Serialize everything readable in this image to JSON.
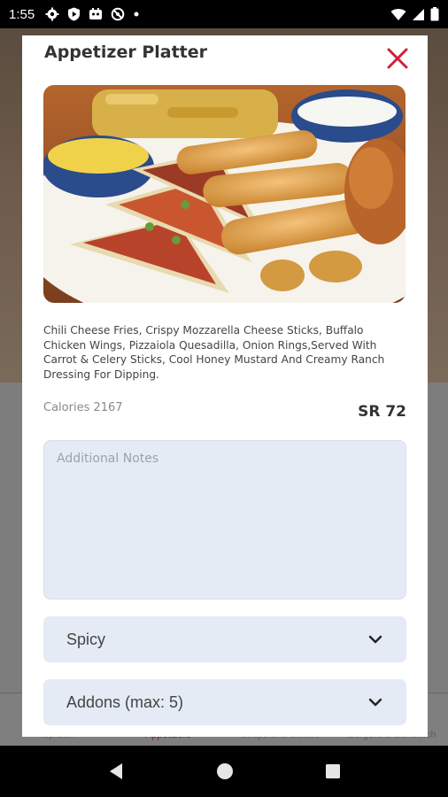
{
  "status_bar": {
    "time": "1:55",
    "icons": [
      "gear-icon",
      "play-shield-icon",
      "robot-icon",
      "no-sync-icon",
      "dot-icon"
    ],
    "right_icons": [
      "wifi-icon",
      "signal-icon",
      "battery-icon"
    ]
  },
  "background_tabs": [
    "Top Sell",
    "Appetizers",
    "Soups and Salads",
    "Burgers & Sandwich"
  ],
  "modal": {
    "title": "Appetizer Platter",
    "description": "Chili Cheese Fries, Crispy Mozzarella Cheese Sticks, Buffalo Chicken Wings, Pizzaiola Quesadilla, Onion Rings,Served With Carrot & Celery Sticks, Cool Honey Mustard And Creamy Ranch Dressing For Dipping.",
    "calories": "Calories 2167",
    "price": "SR 72",
    "notes_placeholder": "Additional Notes",
    "options": [
      {
        "label": "Spicy"
      },
      {
        "label": "Addons (max: 5)"
      }
    ],
    "accent_color": "#d21f3c"
  },
  "nav_bar": {
    "icons": [
      "back-icon",
      "home-icon",
      "recents-icon"
    ]
  }
}
